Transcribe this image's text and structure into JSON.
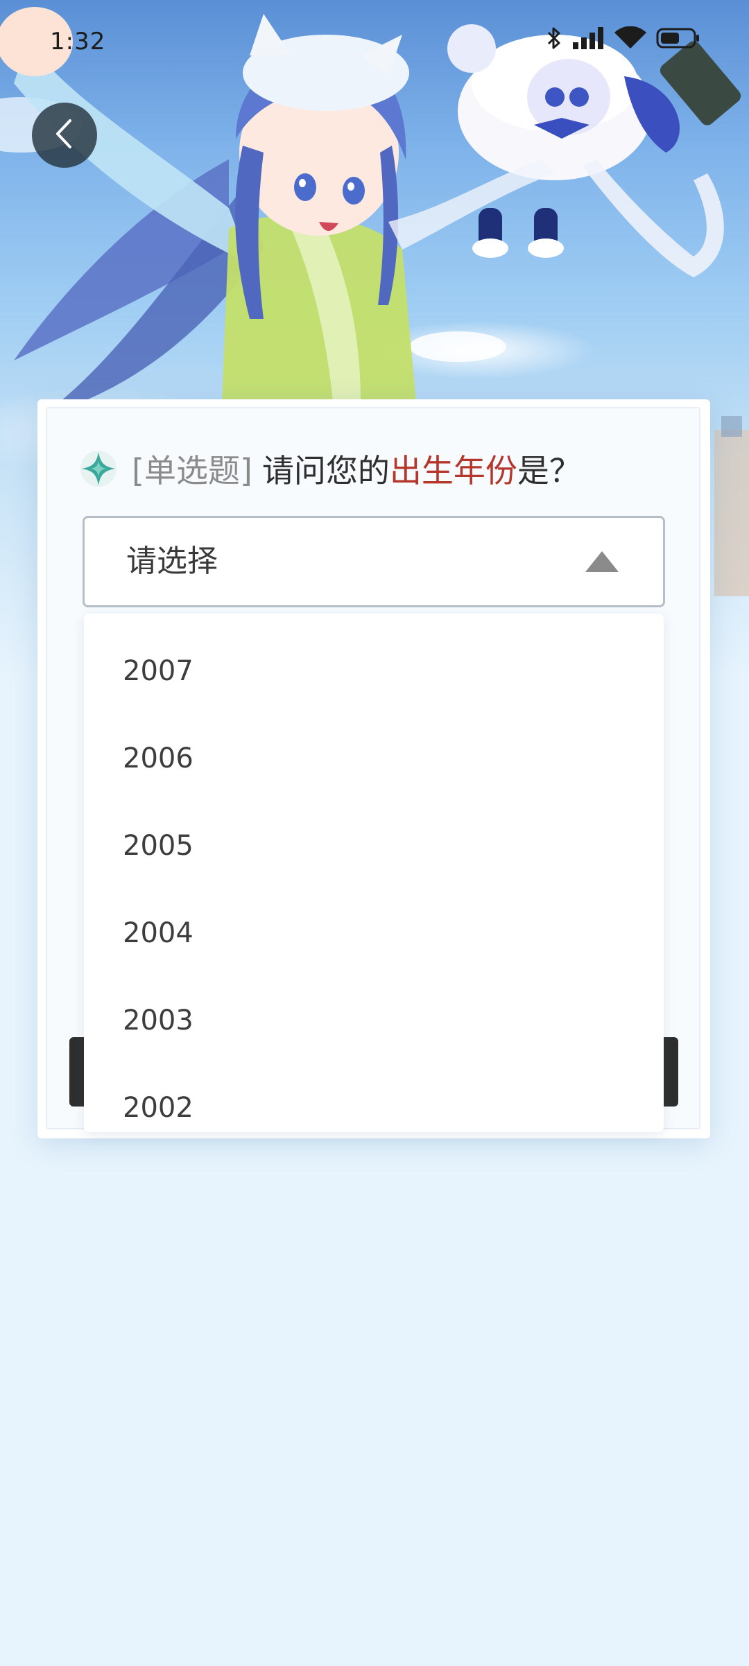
{
  "status_bar": {
    "time": "1:32",
    "icons": [
      "bluetooth-icon",
      "signal-icon",
      "wifi-icon",
      "battery-icon"
    ]
  },
  "back_button": {
    "icon": "chevron-left-icon"
  },
  "question": {
    "icon": "sparkle-icon",
    "type_tag": "[单选题]",
    "text_before": "请问您的",
    "text_highlight": "出生年份",
    "text_after": "是？"
  },
  "select": {
    "placeholder": "请选择",
    "arrow_icon": "caret-up-icon"
  },
  "dropdown": {
    "options": [
      "2007",
      "2006",
      "2005",
      "2004",
      "2003",
      "2002"
    ]
  },
  "colors": {
    "highlight": "#b5362b",
    "tag_gray": "#8b8b8b",
    "page_background": "#e7f4fd"
  }
}
